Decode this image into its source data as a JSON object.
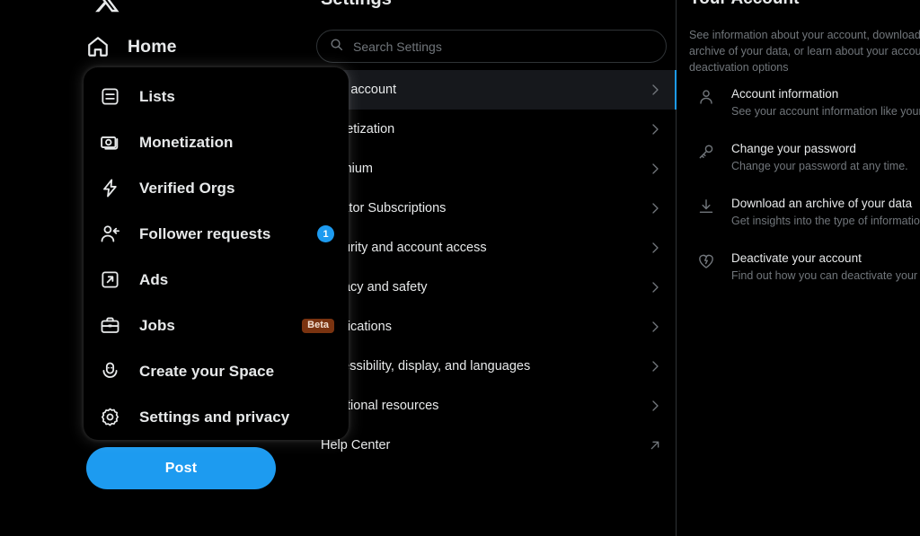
{
  "app": {
    "logo_icon": "x-logo-icon",
    "background": "#000000",
    "accent": "#1d9bf0"
  },
  "left_nav": {
    "home": {
      "label": "Home",
      "icon": "home-icon"
    },
    "post_button": {
      "label": "Post"
    }
  },
  "more_menu": {
    "items": [
      {
        "label": "Lists",
        "icon": "lists-icon",
        "badge": null,
        "badge_type": null
      },
      {
        "label": "Monetization",
        "icon": "monetization-icon",
        "badge": null,
        "badge_type": null
      },
      {
        "label": "Verified Orgs",
        "icon": "verified-orgs-icon",
        "badge": null,
        "badge_type": null
      },
      {
        "label": "Follower requests",
        "icon": "follower-requests-icon",
        "badge": "1",
        "badge_type": "count"
      },
      {
        "label": "Ads",
        "icon": "ads-icon",
        "badge": null,
        "badge_type": null
      },
      {
        "label": "Jobs",
        "icon": "jobs-icon",
        "badge": "Beta",
        "badge_type": "beta"
      },
      {
        "label": "Create your Space",
        "icon": "spaces-icon",
        "badge": null,
        "badge_type": null
      },
      {
        "label": "Settings and privacy",
        "icon": "gear-icon",
        "badge": null,
        "badge_type": null
      }
    ]
  },
  "settings": {
    "title": "Settings",
    "search": {
      "placeholder": "Search Settings",
      "value": "",
      "icon": "search-icon"
    },
    "rows": [
      {
        "label": "Your account",
        "selected": true,
        "external": false
      },
      {
        "label": "Monetization",
        "selected": false,
        "external": false
      },
      {
        "label": "Premium",
        "selected": false,
        "external": false
      },
      {
        "label": "Creator Subscriptions",
        "selected": false,
        "external": false
      },
      {
        "label": "Security and account access",
        "selected": false,
        "external": false
      },
      {
        "label": "Privacy and safety",
        "selected": false,
        "external": false
      },
      {
        "label": "Notifications",
        "selected": false,
        "external": false
      },
      {
        "label": "Accessibility, display, and languages",
        "selected": false,
        "external": false
      },
      {
        "label": "Additional resources",
        "selected": false,
        "external": false
      },
      {
        "label": "Help Center",
        "selected": false,
        "external": true
      }
    ]
  },
  "detail": {
    "title": "Your Account",
    "description": "See information about your account, download an archive of your data, or learn about your account deactivation options",
    "rows": [
      {
        "title": "Account information",
        "subtitle": "See your account information like your phone number and email address.",
        "icon": "person-icon"
      },
      {
        "title": "Change your password",
        "subtitle": "Change your password at any time.",
        "icon": "key-icon"
      },
      {
        "title": "Download an archive of your data",
        "subtitle": "Get insights into the type of information stored for your account.",
        "icon": "download-icon"
      },
      {
        "title": "Deactivate your account",
        "subtitle": "Find out how you can deactivate your account.",
        "icon": "broken-heart-icon"
      }
    ]
  }
}
